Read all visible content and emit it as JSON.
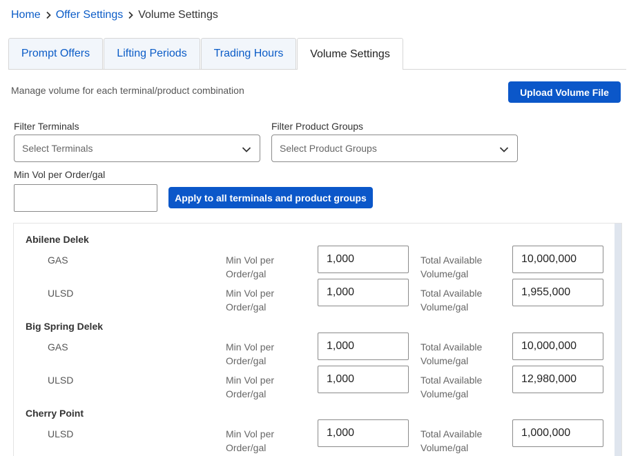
{
  "breadcrumb": {
    "home": "Home",
    "offer_settings": "Offer Settings",
    "current": "Volume Settings"
  },
  "tabs": [
    {
      "label": "Prompt Offers",
      "active": false
    },
    {
      "label": "Lifting Periods",
      "active": false
    },
    {
      "label": "Trading Hours",
      "active": false
    },
    {
      "label": "Volume Settings",
      "active": true
    }
  ],
  "description": "Manage volume for each terminal/product combination",
  "upload_button": "Upload Volume File",
  "filters": {
    "terminals_label": "Filter Terminals",
    "terminals_placeholder": "Select Terminals",
    "products_label": "Filter Product Groups",
    "products_placeholder": "Select Product Groups",
    "min_vol_label": "Min Vol per Order/gal",
    "min_vol_value": "",
    "apply_button": "Apply to all terminals and product groups"
  },
  "field_labels": {
    "min_line1": "Min Vol per",
    "min_line2": "Order/gal",
    "total_line1": "Total Available",
    "total_line2": "Volume/gal"
  },
  "terminals": [
    {
      "name": "Abilene Delek",
      "products": [
        {
          "name": "GAS",
          "min_vol": "1,000",
          "total_vol": "10,000,000"
        },
        {
          "name": "ULSD",
          "min_vol": "1,000",
          "total_vol": "1,955,000"
        }
      ]
    },
    {
      "name": "Big Spring Delek",
      "products": [
        {
          "name": "GAS",
          "min_vol": "1,000",
          "total_vol": "10,000,000"
        },
        {
          "name": "ULSD",
          "min_vol": "1,000",
          "total_vol": "12,980,000"
        }
      ]
    },
    {
      "name": "Cherry Point",
      "products": [
        {
          "name": "ULSD",
          "min_vol": "1,000",
          "total_vol": "1,000,000"
        }
      ]
    }
  ],
  "colors": {
    "link": "#0b5cc7",
    "primary_button": "#0b57c9",
    "tab_inactive_bg": "#f2f6fb"
  }
}
